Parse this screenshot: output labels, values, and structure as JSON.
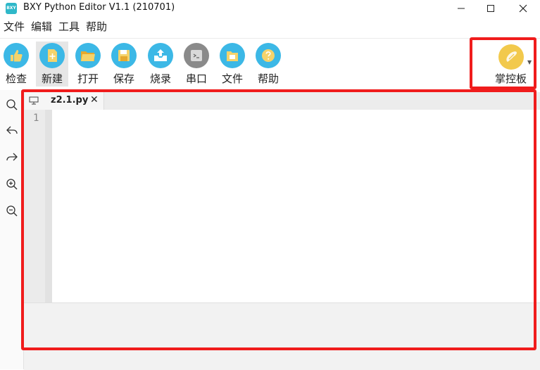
{
  "window": {
    "app_icon_text": "BXY",
    "title": "BXY Python Editor V1.1 (210701)"
  },
  "menu": [
    "文件",
    "编辑",
    "工具",
    "帮助"
  ],
  "toolbar": [
    {
      "label": "检查",
      "icon": "thumbs-up-icon",
      "color": "#3cb8e6"
    },
    {
      "label": "新建",
      "icon": "new-file-icon",
      "color": "#3cb8e6"
    },
    {
      "label": "打开",
      "icon": "open-folder-icon",
      "color": "#3cb8e6"
    },
    {
      "label": "保存",
      "icon": "save-icon",
      "color": "#3cb8e6"
    },
    {
      "label": "烧录",
      "icon": "upload-icon",
      "color": "#3cb8e6"
    },
    {
      "label": "串口",
      "icon": "terminal-icon",
      "color": "#8a8a8a"
    },
    {
      "label": "文件",
      "icon": "file-manager-icon",
      "color": "#3cb8e6"
    },
    {
      "label": "帮助",
      "icon": "help-icon",
      "color": "#3cb8e6"
    }
  ],
  "board": {
    "label": "掌控板",
    "icon": "board-icon",
    "color": "#f2c94c"
  },
  "sidebar_icons": [
    "search-icon",
    "undo-icon",
    "redo-icon",
    "zoom-in-icon",
    "zoom-out-icon"
  ],
  "editor": {
    "tab_label": "z2.1.py",
    "tab_close": "✕",
    "line_numbers": [
      "1"
    ]
  },
  "colors": {
    "highlight": "#f01c1c",
    "accent": "#3cb8e6"
  }
}
